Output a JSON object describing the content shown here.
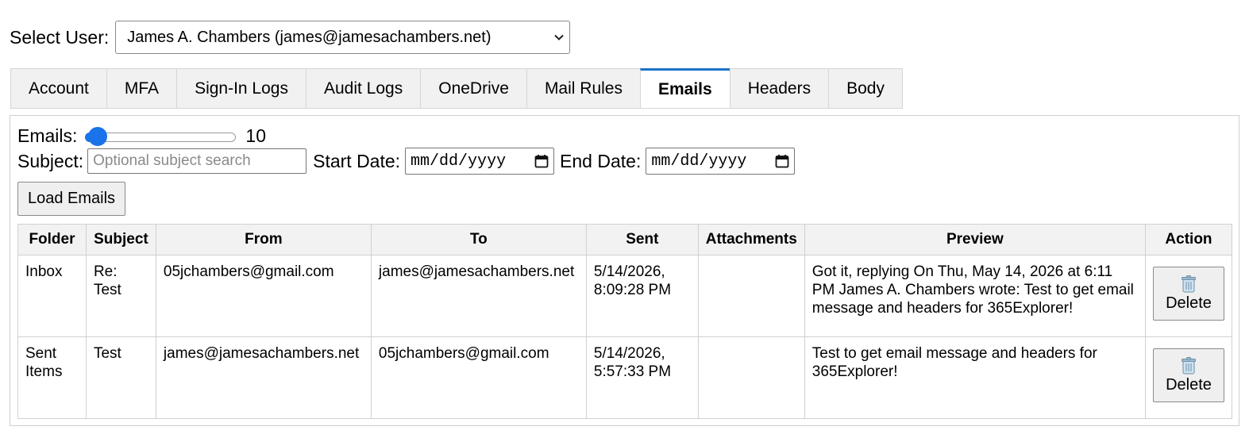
{
  "user_select": {
    "label": "Select User:",
    "value": "James A. Chambers (james@jamesachambers.net)"
  },
  "tabs": [
    {
      "label": "Account",
      "active": false
    },
    {
      "label": "MFA",
      "active": false
    },
    {
      "label": "Sign-In Logs",
      "active": false
    },
    {
      "label": "Audit Logs",
      "active": false
    },
    {
      "label": "OneDrive",
      "active": false
    },
    {
      "label": "Mail Rules",
      "active": false
    },
    {
      "label": "Emails",
      "active": true
    },
    {
      "label": "Headers",
      "active": false
    },
    {
      "label": "Body",
      "active": false
    }
  ],
  "filters": {
    "emails_label": "Emails:",
    "emails_count": "10",
    "slider_fraction": 0.08,
    "subject_label": "Subject:",
    "subject_placeholder": "Optional subject search",
    "start_label": "Start Date:",
    "start_placeholder": "mm/dd/yyyy",
    "end_label": "End Date:",
    "end_placeholder": "mm/dd/yyyy",
    "load_button": "Load Emails"
  },
  "table": {
    "columns": [
      "Folder",
      "Subject",
      "From",
      "To",
      "Sent",
      "Attachments",
      "Preview",
      "Action"
    ],
    "rows": [
      {
        "folder": "Inbox",
        "subject": "Re: Test",
        "from": "05jchambers@gmail.com",
        "to": "james@jamesachambers.net",
        "sent": "5/14/2026, 8:09:28 PM",
        "attachments": "",
        "preview": "Got it, replying On Thu, May 14, 2026 at 6:11 PM James A. Chambers wrote: Test to get email message and headers for 365Explorer!",
        "action": "Delete"
      },
      {
        "folder": "Sent Items",
        "subject": "Test",
        "from": "james@jamesachambers.net",
        "to": "05jchambers@gmail.com",
        "sent": "5/14/2026, 5:57:33 PM",
        "attachments": "",
        "preview": "Test to get email message and headers for 365Explorer!",
        "action": "Delete"
      }
    ]
  },
  "colors": {
    "accent": "#1a73e8",
    "tab_active_border": "#1a73c8"
  },
  "icons": {
    "select_arrow": "chevron-down-icon",
    "date_picker": "calendar-icon",
    "delete": "trash-icon"
  }
}
